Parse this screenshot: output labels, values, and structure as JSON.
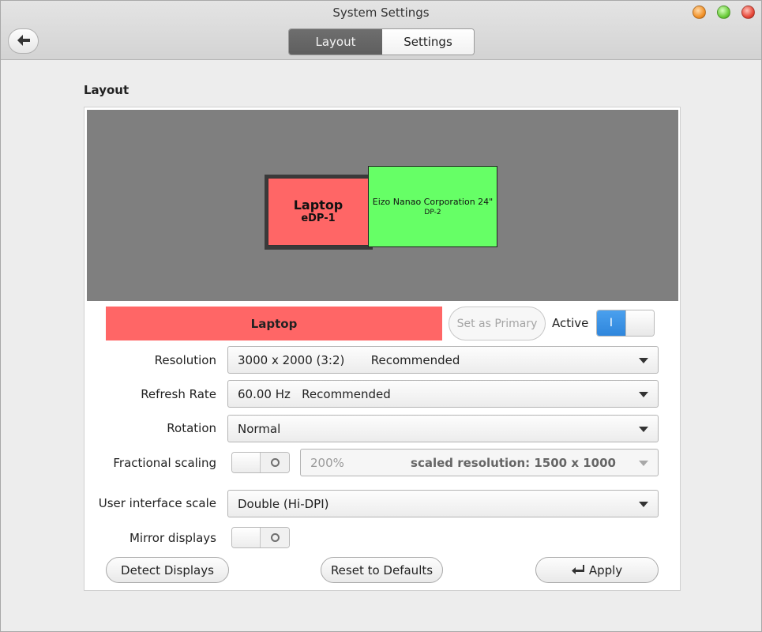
{
  "window": {
    "title": "System Settings"
  },
  "header": {
    "tabs": [
      {
        "label": "Layout",
        "active": true
      },
      {
        "label": "Settings",
        "active": false
      }
    ]
  },
  "section": {
    "title": "Layout"
  },
  "monitors": [
    {
      "name": "Laptop",
      "port": "eDP-1",
      "color": "#ff6666",
      "selected": true
    },
    {
      "name": "Eizo Nanao Corporation 24\"",
      "port": "DP-2",
      "color": "#66ff66",
      "selected": false
    }
  ],
  "selected_output": {
    "name": "Laptop",
    "set_primary_label": "Set as Primary",
    "active_label": "Active",
    "active_on": true,
    "active_switch_glyph": "I"
  },
  "settings": {
    "resolution": {
      "label": "Resolution",
      "value": "3000 x 2000 (3:2)       Recommended"
    },
    "refresh_rate": {
      "label": "Refresh Rate",
      "value": "60.00 Hz   Recommended"
    },
    "rotation": {
      "label": "Rotation",
      "value": "Normal"
    },
    "fractional_scaling": {
      "label": "Fractional scaling",
      "enabled": false,
      "value": "200%",
      "scaled_resolution": "scaled resolution: 1500 x 1000"
    },
    "ui_scale": {
      "label": "User interface scale",
      "value": "Double (Hi-DPI)"
    },
    "mirror_displays": {
      "label": "Mirror displays",
      "enabled": false
    }
  },
  "actions": {
    "detect": "Detect Displays",
    "reset": "Reset to Defaults",
    "apply": "Apply"
  },
  "icons": {
    "back": "arrow-left-icon",
    "apply": "return-arrow-icon"
  }
}
